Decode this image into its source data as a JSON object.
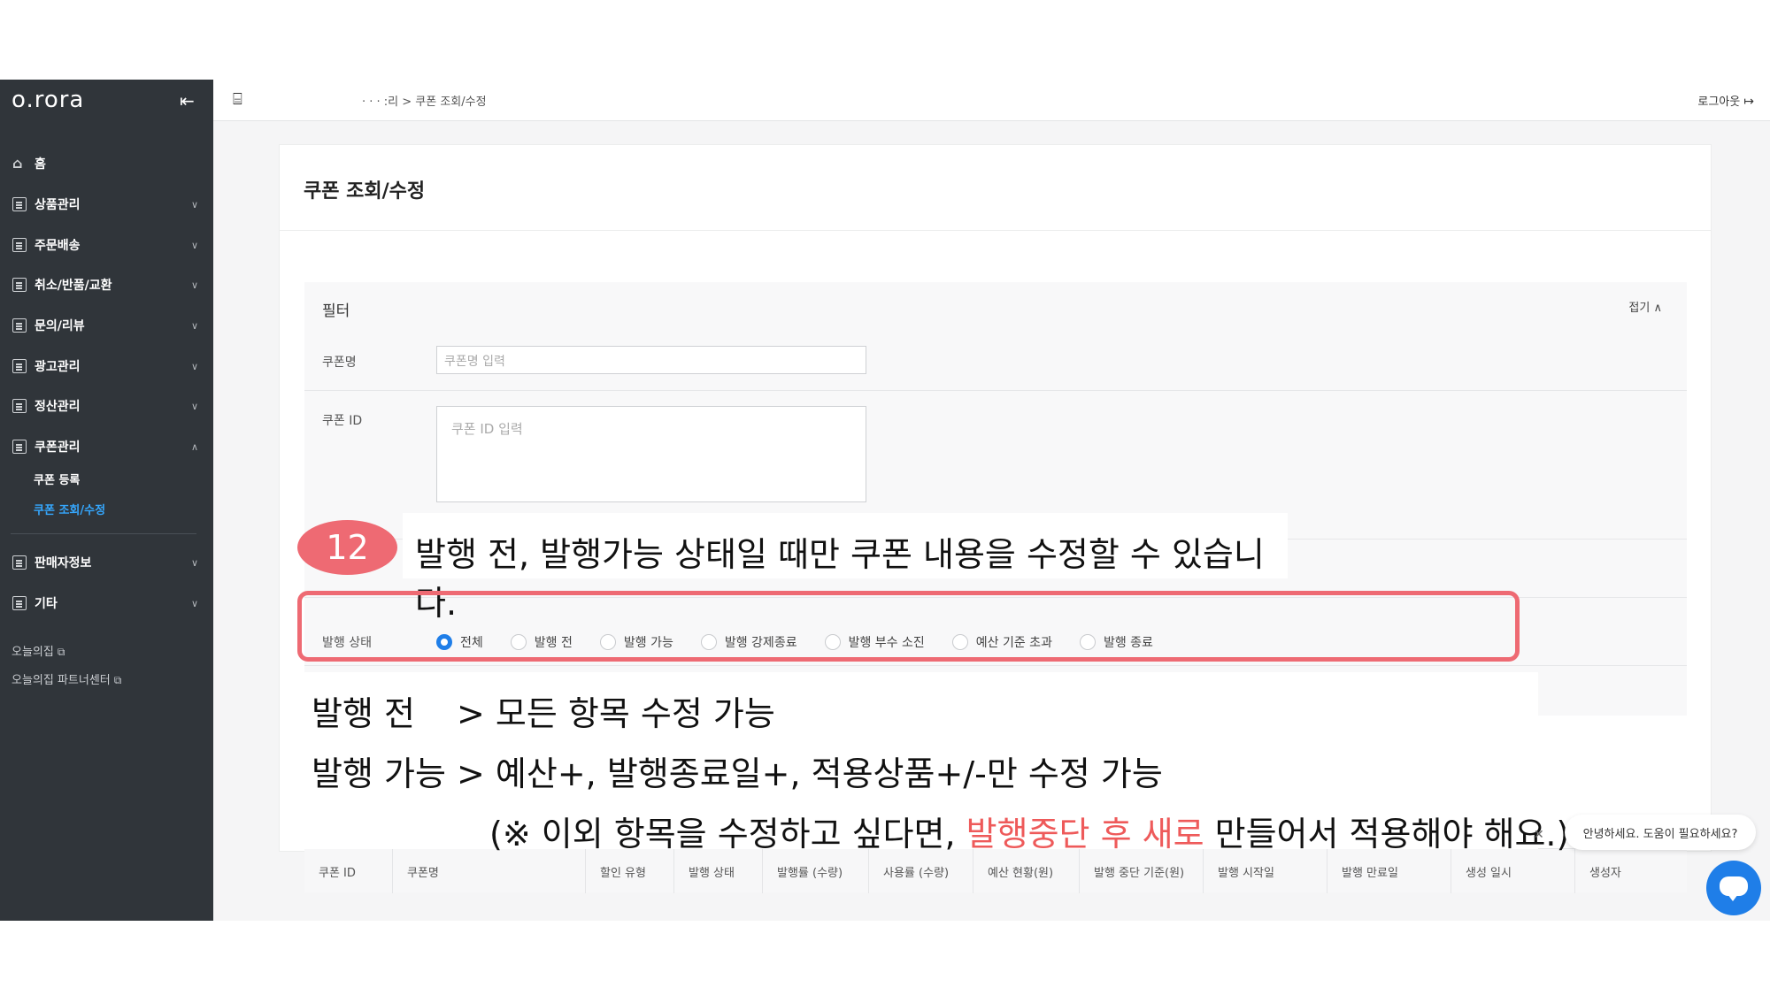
{
  "sidebar": {
    "logo": "o.rora",
    "home": "홈",
    "items": [
      "상품관리",
      "주문배송",
      "취소/반품/교환",
      "문의/리뷰",
      "광고관리",
      "정산관리",
      "쿠폰관리"
    ],
    "coupon_sub": [
      "쿠폰 등록",
      "쿠폰 조회/수정"
    ],
    "items_after": [
      "판매자정보",
      "기타"
    ],
    "external_links": [
      "오늘의집",
      "오늘의집 파트너센터"
    ]
  },
  "topbar": {
    "breadcrumb": "·  ·  ·   :리 > 쿠폰 조회/수정",
    "logout": "로그아웃"
  },
  "page": {
    "title": "쿠폰 조회/수정"
  },
  "filter": {
    "title": "필터",
    "fold": "접기",
    "coupon_name_label": "쿠폰명",
    "coupon_name_placeholder": "쿠폰명 입력",
    "coupon_id_label": "쿠폰 ID",
    "coupon_id_placeholder": "쿠폰 ID 입력",
    "status_label": "발행 상태",
    "status_options": [
      "전체",
      "발행 전",
      "발행 가능",
      "발행 강제종료",
      "발행 부수 소진",
      "예산 기준 초과",
      "발행 종료"
    ],
    "status_selected": "전체"
  },
  "table": {
    "headers": [
      "쿠폰 ID",
      "쿠폰명",
      "할인 유형",
      "발행 상태",
      "발행률 (수량)",
      "사용률 (수량)",
      "예산 현황(원)",
      "발행 중단 기준(원)",
      "발행 시작일",
      "발행 만료일",
      "생성 일시",
      "생성자"
    ]
  },
  "annotation": {
    "step": "12",
    "caption": "발행 전, 발행가능 상태일 때만 쿠폰 내용을 수정할 수 있습니다.",
    "line1_tag": "발행 전",
    "line1_text": ">  모든 항목 수정 가능",
    "line2_tag": "발행 가능",
    "line2_text": ">  예산+, 발행종료일+, 적용상품+/-만 수정 가능",
    "line3_pre": "(※ 이외 항목을 수정하고 싶다면, ",
    "line3_red": "발행중단 후 새로",
    "line3_post": " 만들어서 적용해야 해요.)"
  },
  "chat": {
    "greeting": "안녕하세요. 도움이 필요하세요?"
  }
}
